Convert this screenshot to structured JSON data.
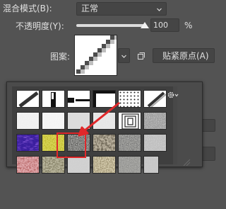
{
  "blend_mode": {
    "label": "混合模式(B):",
    "value": "正常"
  },
  "opacity": {
    "label": "不透明度(Y):",
    "value": "100",
    "unit": "%",
    "level": 1.0
  },
  "pattern": {
    "label": "图案:",
    "snap_button": "贴紧原点(A)"
  },
  "picker": {
    "gear": "gear-icon",
    "rows": [
      [
        {
          "name": "diagonal-thick-line"
        },
        {
          "name": "vertical-bar"
        },
        {
          "name": "horizontal-dash"
        },
        {
          "name": "black-frame"
        },
        {
          "name": "dot-grid"
        },
        {
          "name": "diagonal-line-small"
        }
      ],
      [
        {
          "name": "white-rough"
        },
        {
          "name": "white-cloth"
        },
        {
          "name": "gray-stone"
        },
        {
          "name": "white-crinkle"
        },
        {
          "name": "concentric-squares"
        },
        {
          "name": "gray-marble"
        }
      ],
      [
        {
          "name": "blue-silk"
        },
        {
          "name": "yellow-felt"
        },
        {
          "name": "dark-gravel",
          "selected": true
        },
        {
          "name": "pebbles"
        },
        {
          "name": "granite"
        },
        {
          "name": "light-granite"
        }
      ],
      [
        {
          "name": "pink-rock"
        },
        {
          "name": "olive-stone"
        },
        {
          "name": "white-plaster"
        },
        {
          "name": "tan-sand"
        },
        {
          "name": "gray-cement"
        },
        {
          "name": "partial-tile"
        }
      ]
    ]
  },
  "annotation_color": "#e0282a",
  "accent": "#dcdcdc"
}
